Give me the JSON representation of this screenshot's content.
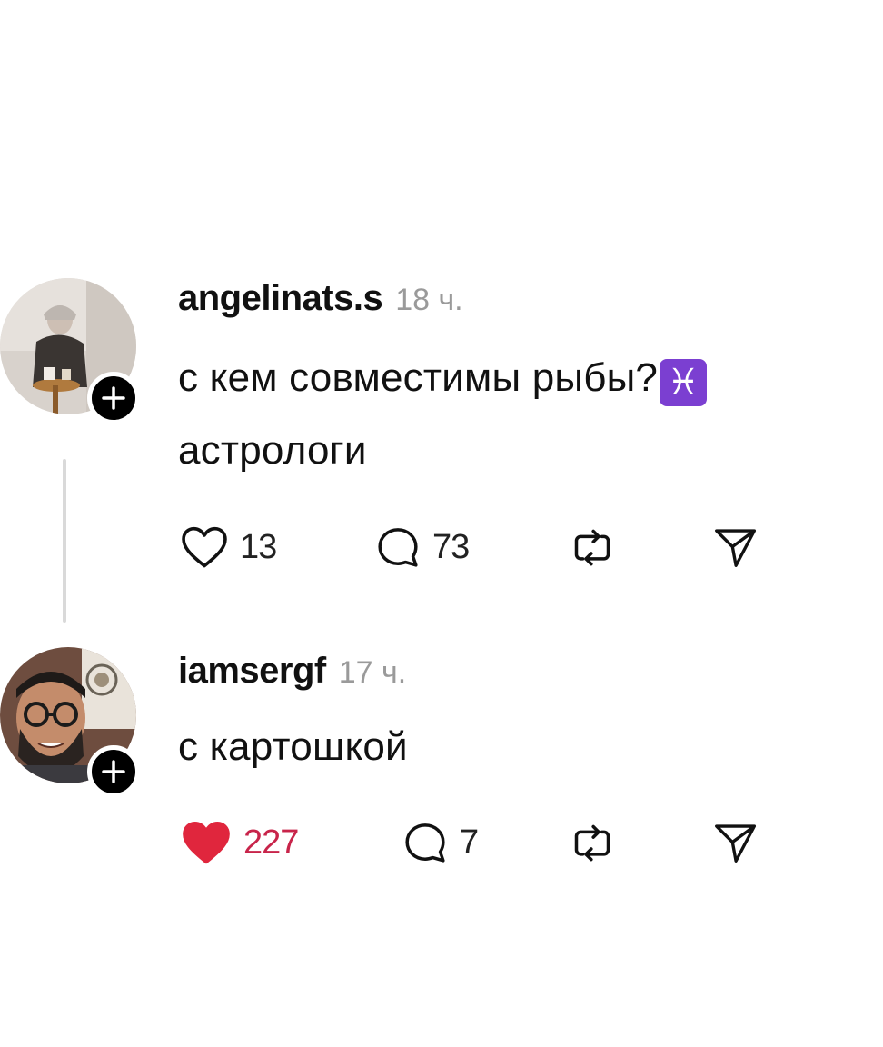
{
  "comments": [
    {
      "username": "angelinats.s",
      "time": "18 ч.",
      "text_line1": "с кем совместимы рыбы?",
      "emoji": "♓",
      "emoji_name": "pisces-emoji",
      "text_line2": "астрологи",
      "likes": "13",
      "replies": "73",
      "liked": false
    },
    {
      "username": "iamsergf",
      "time": "17 ч.",
      "text_line1": "с картошкой",
      "likes": "227",
      "replies": "7",
      "liked": true
    }
  ],
  "colors": {
    "liked_heart": "#e0263d",
    "liked_count": "#c8244a",
    "emoji_bg": "#7b3fd1",
    "time": "#9a9a9a",
    "thread_line": "#d9d9d9"
  },
  "icons": {
    "like": "heart-icon",
    "reply": "comment-bubble-icon",
    "repost": "repost-icon",
    "share": "send-icon",
    "follow": "plus-icon"
  }
}
